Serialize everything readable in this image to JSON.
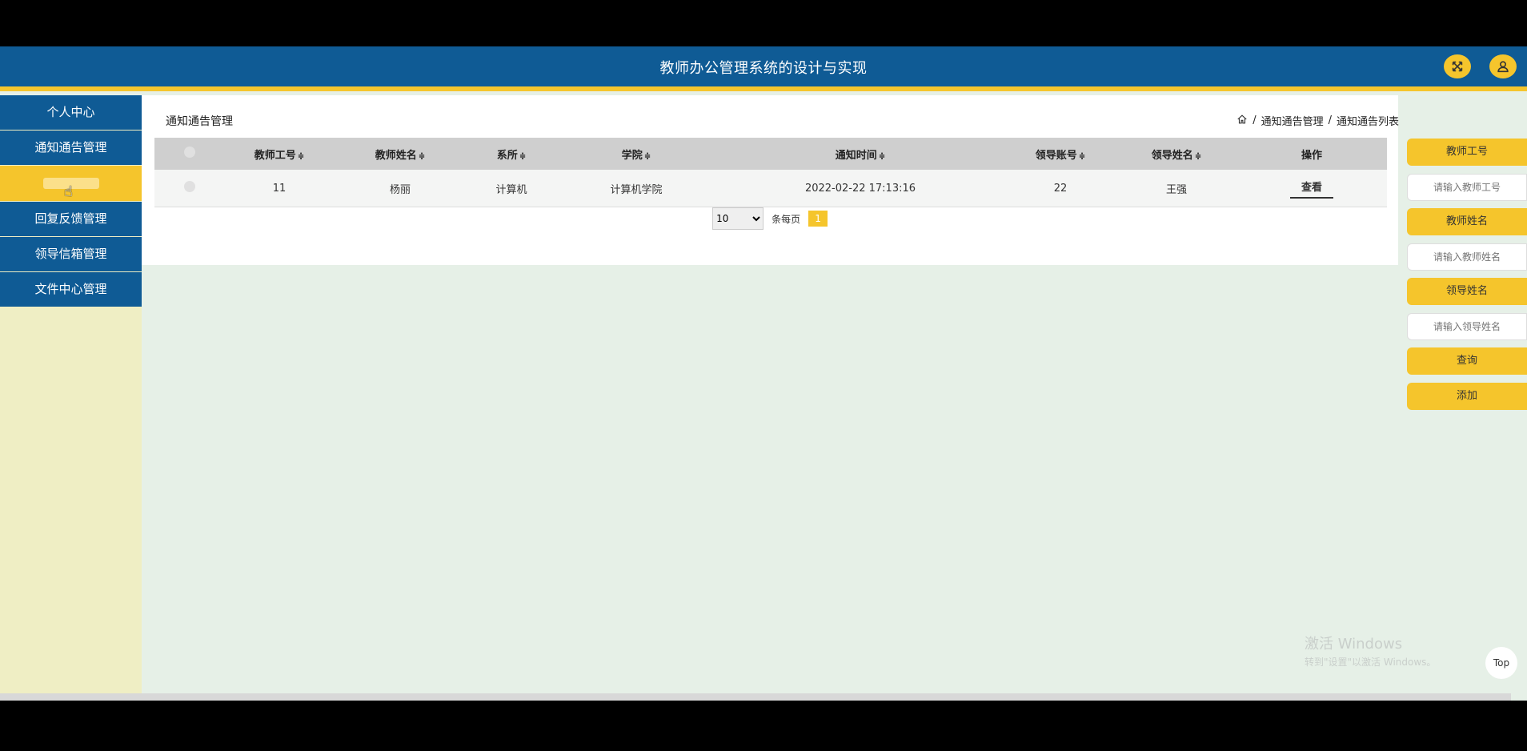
{
  "header": {
    "title": "教师办公管理系统的设计与实现",
    "icons": [
      "expand-icon",
      "user-icon"
    ]
  },
  "sidebar": {
    "items": [
      {
        "label": "个人中心"
      },
      {
        "label": "通知通告管理"
      },
      {
        "label": ""
      },
      {
        "label": "回复反馈管理"
      },
      {
        "label": "领导信箱管理"
      },
      {
        "label": "文件中心管理"
      }
    ]
  },
  "content": {
    "title": "通知通告管理",
    "breadcrumb": {
      "home_icon": "home-icon",
      "sep": "/",
      "level1": "通知通告管理",
      "level2": "通知通告列表"
    }
  },
  "table": {
    "headers": [
      "教师工号",
      "教师姓名",
      "系所",
      "学院",
      "通知时间",
      "领导账号",
      "领导姓名",
      "操作"
    ],
    "sort_symbol": "≑",
    "rows": [
      {
        "teacher_id": "11",
        "teacher_name": "杨丽",
        "dept": "计算机",
        "college": "计算机学院",
        "time": "2022-02-22 17:13:16",
        "leader_account": "22",
        "leader_name": "王强",
        "action": "查看"
      }
    ]
  },
  "pager": {
    "page_size": "10",
    "per_page_label": "条每页",
    "current_page": "1"
  },
  "search_panel": {
    "teacher_id_label": "教师工号",
    "teacher_id_placeholder": "请输入教师工号",
    "teacher_name_label": "教师姓名",
    "teacher_name_placeholder": "请输入教师姓名",
    "leader_name_label": "领导姓名",
    "leader_name_placeholder": "请输入领导姓名",
    "query_button": "查询",
    "add_button": "添加"
  },
  "watermark": {
    "line1": "激活 Windows",
    "line2": "转到\"设置\"以激活 Windows。"
  },
  "top_button": "Top",
  "colors": {
    "primary": "#0f5b95",
    "accent": "#f5c52c",
    "background": "#e6f0e7",
    "sidebar_bg": "#efeec4"
  }
}
